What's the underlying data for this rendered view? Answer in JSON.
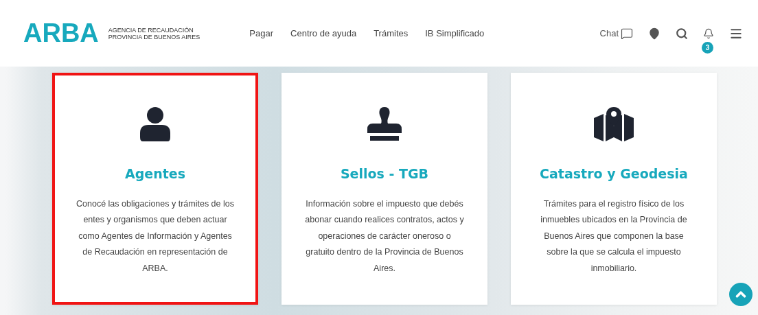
{
  "header": {
    "logo": "ARBA",
    "agency_lines": [
      "AGENCIA DE RECAUDACIÓN",
      "PROVINCIA DE BUENOS AIRES"
    ],
    "nav": [
      "Pagar",
      "Centro de ayuda",
      "Trámites",
      "IB Simplificado"
    ],
    "chat": "Chat",
    "notifications_count": "3"
  },
  "cards": [
    {
      "kind": "person",
      "title": "Agentes",
      "description": "Conocé las obligaciones y trámites de los entes y organismos que deben actuar como Agentes de Información y Agentes de Recaudación en representación de ARBA.",
      "selected": true
    },
    {
      "kind": "stamp",
      "title": "Sellos - TGB",
      "description": "Información sobre el impuesto que debés abonar cuando realices contratos, actos y operaciones de carácter oneroso o gratuito dentro de la Provincia de Buenos Aires.",
      "selected": false
    },
    {
      "kind": "map",
      "title": "Catastro y Geodesia",
      "description": "Trámites para el registro físico de los inmuebles ubicados en la Provincia de Buenos Aires que componen la base sobre la que se calcula el impuesto inmobiliario.",
      "selected": false
    }
  ]
}
